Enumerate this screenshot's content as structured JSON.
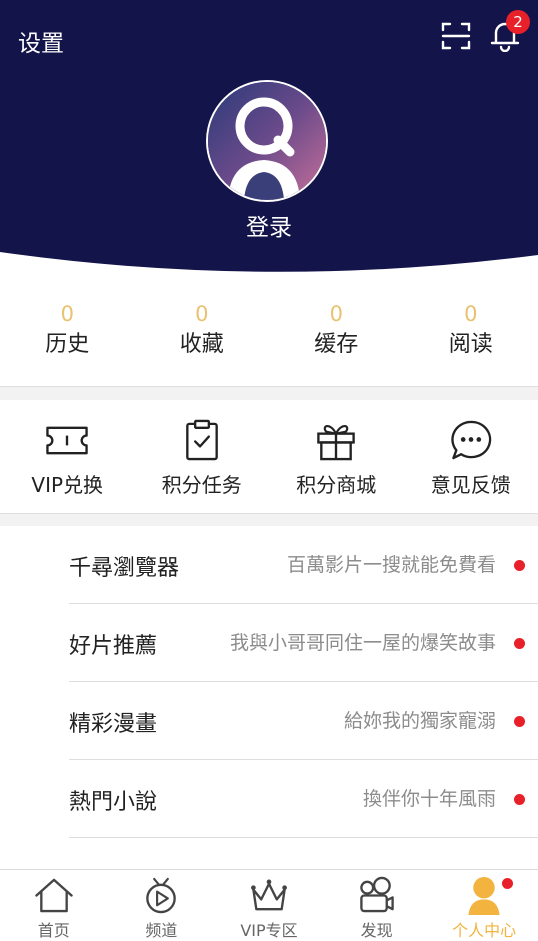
{
  "header": {
    "settings_label": "设置",
    "notification_count": "2",
    "login_label": "登录"
  },
  "colors": {
    "header_bg": "#13144a",
    "accent": "#f2b43f",
    "stat_value": "#e9c271",
    "badge": "#e8202a"
  },
  "stats": [
    {
      "value": "0",
      "label": "历史"
    },
    {
      "value": "0",
      "label": "收藏"
    },
    {
      "value": "0",
      "label": "缓存"
    },
    {
      "value": "0",
      "label": "阅读"
    }
  ],
  "actions": [
    {
      "icon": "ticket-icon",
      "label": "VIP兑换"
    },
    {
      "icon": "clipboard-check-icon",
      "label": "积分任务"
    },
    {
      "icon": "gift-icon",
      "label": "积分商城"
    },
    {
      "icon": "chat-bubble-icon",
      "label": "意见反馈"
    }
  ],
  "list": [
    {
      "title": "千尋瀏覽器",
      "desc": "百萬影片一搜就能免費看"
    },
    {
      "title": "好片推薦",
      "desc": "我與小哥哥同住一屋的爆笑故事"
    },
    {
      "title": "精彩漫畫",
      "desc": "給妳我的獨家寵溺"
    },
    {
      "title": "熱門小說",
      "desc": "換伴你十年風雨"
    }
  ],
  "tabs": [
    {
      "icon": "home-icon",
      "label": "首页"
    },
    {
      "icon": "tv-play-icon",
      "label": "频道"
    },
    {
      "icon": "crown-icon",
      "label": "VIP专区"
    },
    {
      "icon": "camera-icon",
      "label": "发现"
    },
    {
      "icon": "person-icon",
      "label": "个人中心"
    }
  ]
}
